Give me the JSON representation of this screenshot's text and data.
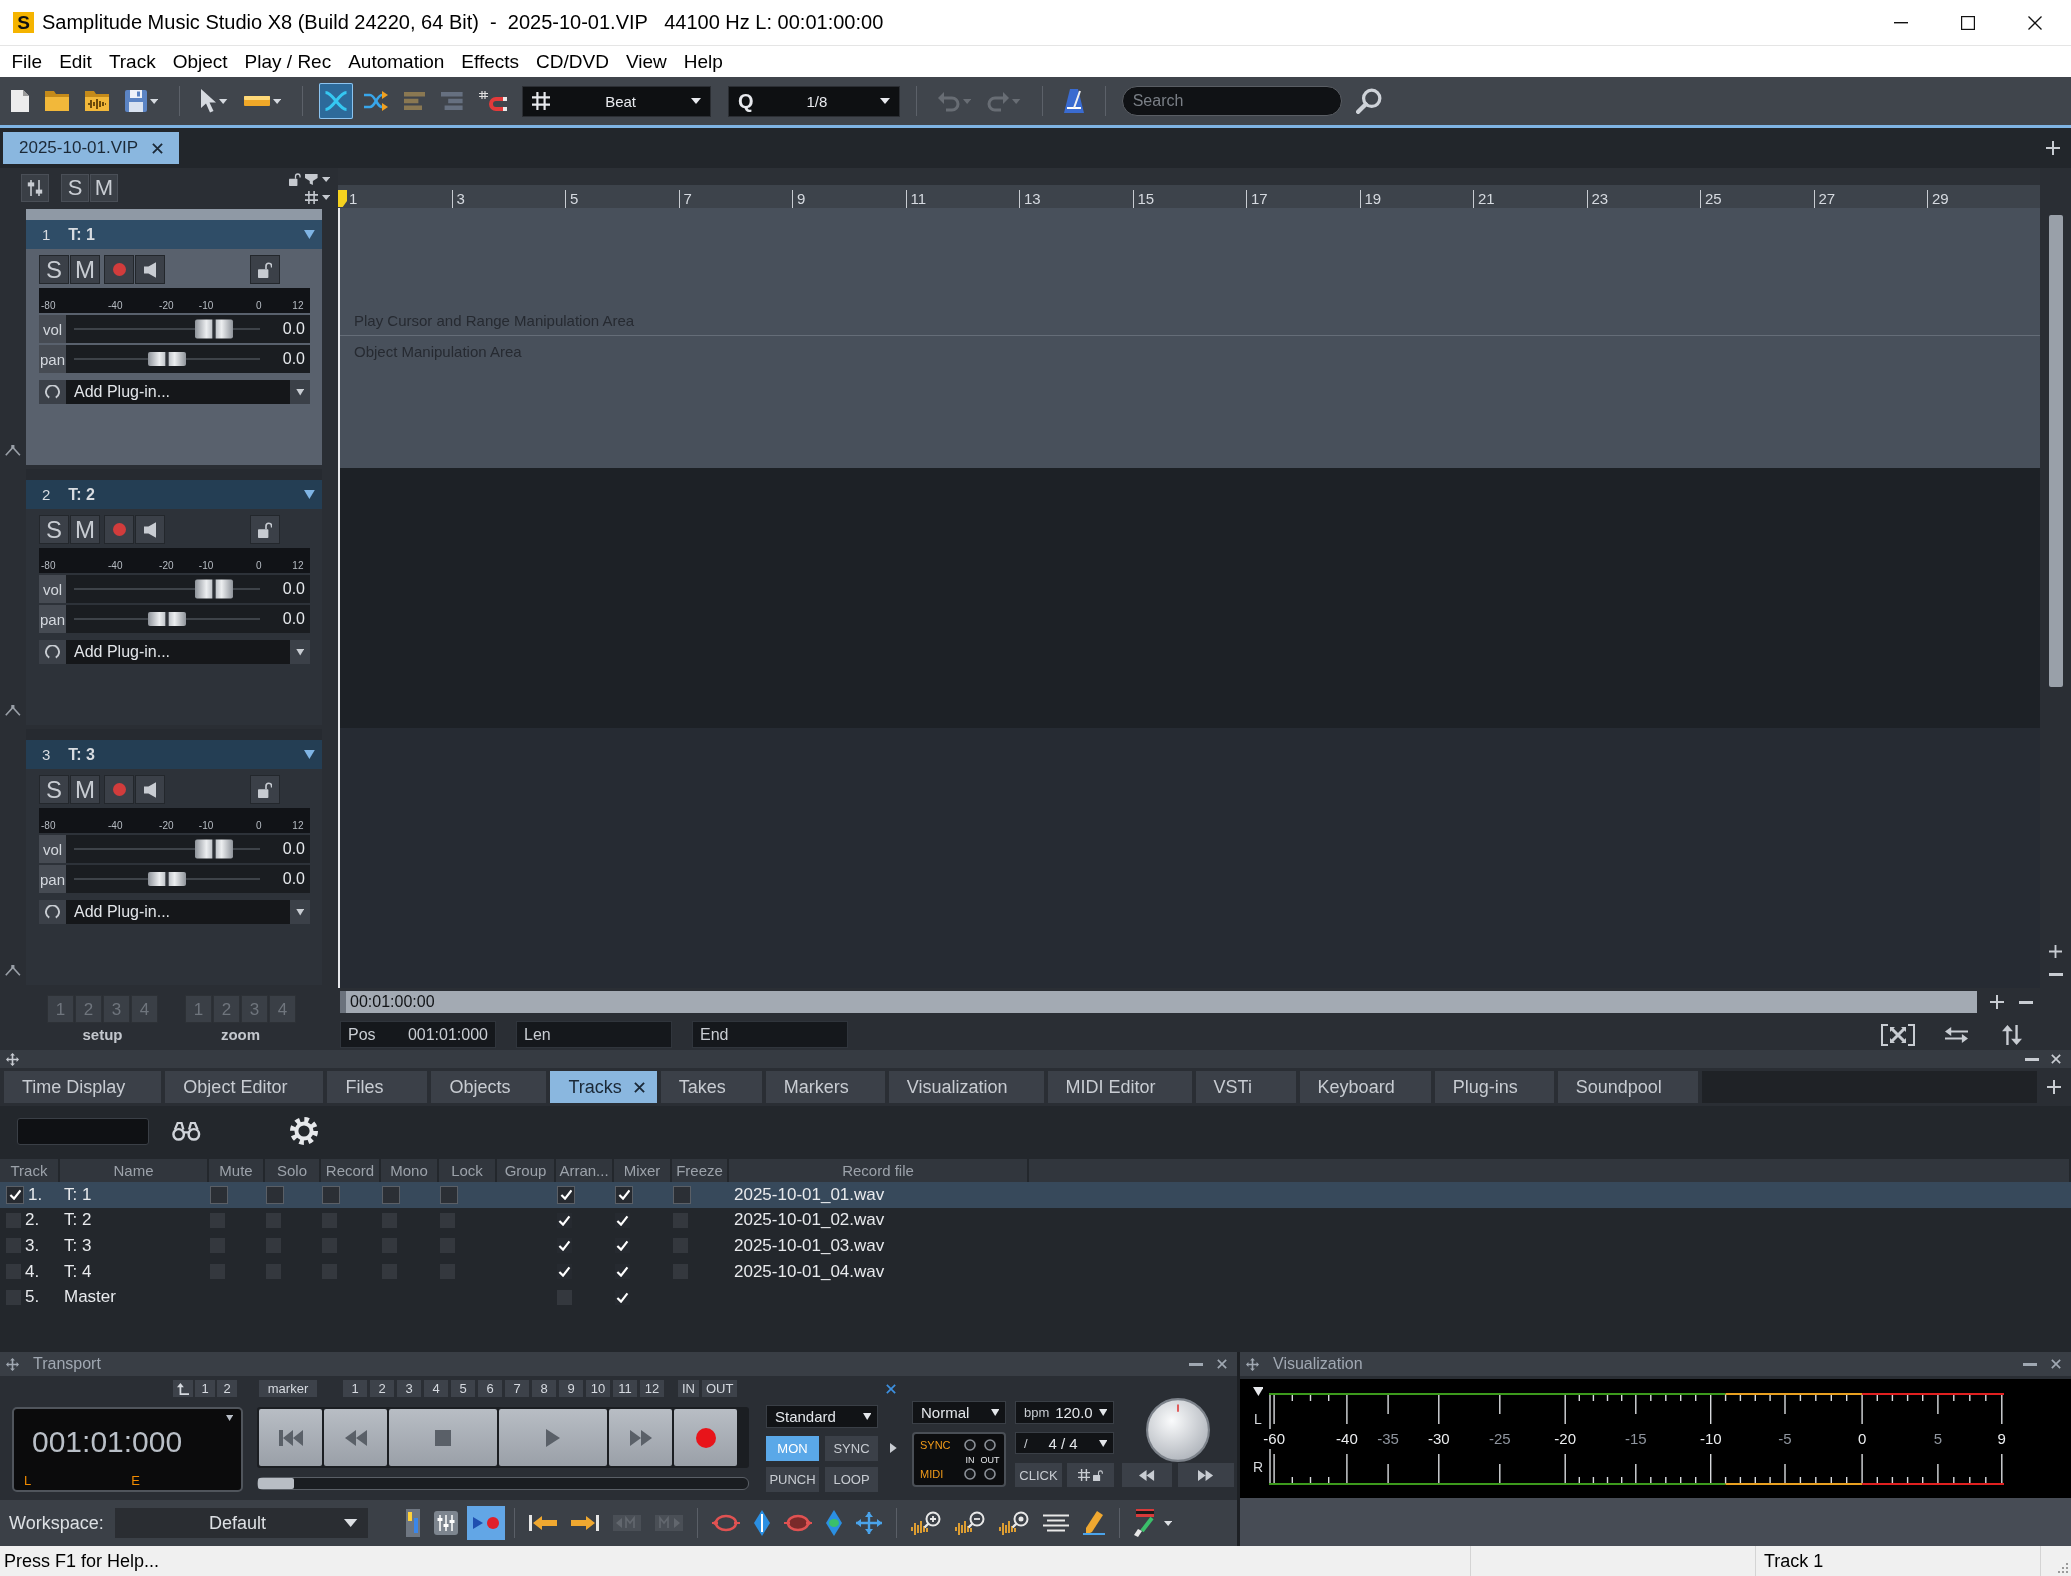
{
  "window": {
    "logo": "S",
    "title": "Samplitude Music Studio X8 (Build 24220, 64 Bit)  -  2025-10-01.VIP   44100 Hz L: 00:01:00:00"
  },
  "menu": [
    "File",
    "Edit",
    "Track",
    "Object",
    "Play / Rec",
    "Automation",
    "Effects",
    "CD/DVD",
    "View",
    "Help"
  ],
  "toolbar": {
    "groups": [
      {
        "buttons": [
          {
            "kind": "new",
            "active": false,
            "disabled": false
          },
          {
            "kind": "open",
            "active": false,
            "disabled": false
          },
          {
            "kind": "project",
            "active": false,
            "disabled": false
          },
          {
            "kind": "save",
            "active": false,
            "disabled": false
          }
        ]
      },
      {
        "buttons": [
          {
            "kind": "pointer",
            "active": false,
            "disabled": false
          },
          {
            "kind": "range",
            "active": false,
            "disabled": false
          }
        ]
      },
      {
        "buttons": [
          {
            "kind": "crossfade",
            "active": true,
            "disabled": false
          },
          {
            "kind": "shuffle",
            "active": false,
            "disabled": false
          },
          {
            "kind": "bars_left",
            "active": false,
            "disabled": false
          },
          {
            "kind": "bars_right",
            "active": false,
            "disabled": false
          },
          {
            "kind": "snap",
            "active": false,
            "disabled": false
          }
        ]
      }
    ],
    "snap": {
      "value": "Beat"
    },
    "quantize": {
      "label": "Q",
      "value": "1/8"
    },
    "more_groups": [
      {
        "buttons": [
          {
            "kind": "undo",
            "active": false,
            "disabled": true
          },
          {
            "kind": "redo",
            "active": false,
            "disabled": true
          }
        ]
      },
      {
        "buttons": [
          {
            "kind": "metronome",
            "active": false,
            "disabled": false
          }
        ]
      }
    ],
    "search": {
      "placeholder": "Search"
    }
  },
  "documents": [
    {
      "label": "2025-10-01.VIP",
      "selected": true
    }
  ],
  "track_header": {
    "buttons": [
      "S",
      "M"
    ]
  },
  "tracks": [
    {
      "number": "1",
      "name": "T: 1",
      "selected": true,
      "solo": {
        "label": "S",
        "on": false
      },
      "mute": {
        "label": "M",
        "on": false
      },
      "armed": false,
      "monitor": false,
      "locked": false,
      "meter_scale": [
        "-80",
        "-40",
        "-20",
        "-10",
        "0",
        "12"
      ],
      "volume": {
        "label": "vol",
        "value": "0.0",
        "level": 0.75
      },
      "pan": {
        "label": "pan",
        "value": "0.0",
        "level": 0.5
      },
      "plugin": "Add Plug-in...",
      "lane_hints": [
        "Play Cursor and Range Manipulation Area",
        "Object Manipulation Area"
      ]
    },
    {
      "number": "2",
      "name": "T: 2",
      "selected": false,
      "solo": {
        "label": "S",
        "on": false
      },
      "mute": {
        "label": "M",
        "on": false
      },
      "armed": false,
      "monitor": false,
      "locked": false,
      "meter_scale": [
        "-80",
        "-40",
        "-20",
        "-10",
        "0",
        "12"
      ],
      "volume": {
        "label": "vol",
        "value": "0.0",
        "level": 0.75
      },
      "pan": {
        "label": "pan",
        "value": "0.0",
        "level": 0.5
      },
      "plugin": "Add Plug-in..."
    },
    {
      "number": "3",
      "name": "T: 3",
      "selected": false,
      "solo": {
        "label": "S",
        "on": false
      },
      "mute": {
        "label": "M",
        "on": false
      },
      "armed": false,
      "monitor": false,
      "locked": false,
      "meter_scale": [
        "-80",
        "-40",
        "-20",
        "-10",
        "0",
        "12"
      ],
      "volume": {
        "label": "vol",
        "value": "0.0",
        "level": 0.75
      },
      "pan": {
        "label": "pan",
        "value": "0.0",
        "level": 0.5
      },
      "plugin": "Add Plug-in..."
    }
  ],
  "left_footer": [
    {
      "label": "setup",
      "buttons": [
        "1",
        "2",
        "3",
        "4"
      ]
    },
    {
      "label": "zoom",
      "buttons": [
        "1",
        "2",
        "3",
        "4"
      ]
    }
  ],
  "arrange": {
    "ruler": [
      "1",
      "3",
      "5",
      "7",
      "9",
      "11",
      "13",
      "15",
      "17",
      "19",
      "21",
      "23",
      "25",
      "27",
      "29"
    ],
    "position": "00:01:00:00",
    "fields": [
      {
        "label": "Pos",
        "value": "001:01:000"
      },
      {
        "label": "Len"
      },
      {
        "label": "End"
      }
    ]
  },
  "dock_tabs": [
    {
      "label": "Time Display",
      "selected": false
    },
    {
      "label": "Object Editor",
      "selected": false
    },
    {
      "label": "Files",
      "selected": false
    },
    {
      "label": "Objects",
      "selected": false
    },
    {
      "label": "Tracks",
      "selected": true
    },
    {
      "label": "Takes",
      "selected": false
    },
    {
      "label": "Markers",
      "selected": false
    },
    {
      "label": "Visualization",
      "selected": false
    },
    {
      "label": "MIDI Editor",
      "selected": false
    },
    {
      "label": "VSTi",
      "selected": false
    },
    {
      "label": "Keyboard",
      "selected": false
    },
    {
      "label": "Plug-ins",
      "selected": false
    },
    {
      "label": "Soundpool",
      "selected": false
    }
  ],
  "track_list": {
    "columns": [
      "Track",
      "Name",
      "Mute",
      "Solo",
      "Record",
      "Mono",
      "Lock",
      "Group",
      "Arran...",
      "Mixer",
      "Freeze",
      "Record file"
    ],
    "rows": [
      {
        "selected": true,
        "checked": true,
        "index": "1.",
        "name": "T: 1",
        "mute": false,
        "solo": false,
        "record": false,
        "mono": false,
        "lock": false,
        "arrange": true,
        "mixer": true,
        "freeze": false,
        "file": "2025-10-01_01.wav"
      },
      {
        "selected": false,
        "checked": false,
        "index": "2.",
        "name": "T: 2",
        "mute": false,
        "solo": false,
        "record": false,
        "mono": false,
        "lock": false,
        "arrange": true,
        "mixer": true,
        "freeze": false,
        "file": "2025-10-01_02.wav"
      },
      {
        "selected": false,
        "checked": false,
        "index": "3.",
        "name": "T: 3",
        "mute": false,
        "solo": false,
        "record": false,
        "mono": false,
        "lock": false,
        "arrange": true,
        "mixer": true,
        "freeze": false,
        "file": "2025-10-01_03.wav"
      },
      {
        "selected": false,
        "checked": false,
        "index": "4.",
        "name": "T: 4",
        "mute": false,
        "solo": false,
        "record": false,
        "mono": false,
        "lock": false,
        "arrange": true,
        "mixer": true,
        "freeze": false,
        "file": "2025-10-01_04.wav"
      },
      {
        "selected": false,
        "checked": false,
        "index": "5.",
        "name": "Master",
        "arrange": false,
        "mixer": true
      }
    ]
  },
  "transport": {
    "title": "Transport",
    "locate_buttons": [
      "1",
      "2"
    ],
    "marker_label": "marker",
    "markers": [
      "1",
      "2",
      "3",
      "4",
      "5",
      "6",
      "7",
      "8",
      "9",
      "10",
      "11",
      "12"
    ],
    "range_buttons": [
      "IN",
      "OUT"
    ],
    "time": "001:01:000",
    "time_flags": [
      "L",
      "E"
    ],
    "controls": [
      {
        "kind": "start"
      },
      {
        "kind": "rewind"
      },
      {
        "kind": "stop"
      },
      {
        "kind": "play"
      },
      {
        "kind": "forward"
      },
      {
        "kind": "record"
      }
    ],
    "mode": "Standard",
    "toggles": [
      {
        "label": "MON",
        "on": true
      },
      {
        "label": "SYNC",
        "on": false
      },
      {
        "label": "PUNCH",
        "on": false
      },
      {
        "label": "LOOP",
        "on": false
      }
    ],
    "play_mode": "Normal",
    "tempo": {
      "label": "bpm",
      "value": "120.0"
    },
    "signature": {
      "label": "/",
      "value": "4 / 4"
    },
    "sync_box": {
      "labels": [
        "SYNC",
        "MIDI"
      ],
      "ports": [
        "IN",
        "OUT"
      ]
    },
    "click": "CLICK"
  },
  "visualization": {
    "title": "Visualization",
    "channels": [
      "L",
      "R"
    ],
    "scale": [
      "-60",
      "-40",
      "-35",
      "-30",
      "-25",
      "-20",
      "-15",
      "-10",
      "-5",
      "0",
      "5",
      "9"
    ]
  },
  "workspace": {
    "label": "Workspace:",
    "value": "Default",
    "groups": [
      {
        "tools": [
          {
            "kind": "strip",
            "active": false,
            "disabled": false
          },
          {
            "kind": "faders",
            "active": false,
            "disabled": false
          },
          {
            "kind": "play_record",
            "active": true,
            "disabled": false
          }
        ]
      },
      {
        "tools": [
          {
            "kind": "jump_left",
            "active": false,
            "disabled": false
          },
          {
            "kind": "jump_right",
            "active": false,
            "disabled": false
          },
          {
            "kind": "marker_left",
            "active": false,
            "disabled": true
          },
          {
            "kind": "marker_right",
            "active": false,
            "disabled": true
          }
        ]
      },
      {
        "tools": [
          {
            "kind": "lens_left",
            "active": false,
            "disabled": false
          },
          {
            "kind": "diamond_left",
            "active": false,
            "disabled": false
          },
          {
            "kind": "lens_right",
            "active": false,
            "disabled": false
          },
          {
            "kind": "diamond_right",
            "active": false,
            "disabled": false
          },
          {
            "kind": "expand",
            "active": false,
            "disabled": false
          }
        ]
      },
      {
        "tools": [
          {
            "kind": "zoom_in",
            "active": false,
            "disabled": false
          },
          {
            "kind": "zoom_out",
            "active": false,
            "disabled": false
          },
          {
            "kind": "zoom_fit",
            "active": false,
            "disabled": false
          },
          {
            "kind": "lines",
            "active": false,
            "disabled": false
          },
          {
            "kind": "pencil",
            "active": false,
            "disabled": false
          }
        ]
      },
      {
        "tools": [
          {
            "kind": "brush",
            "active": false,
            "disabled": false
          }
        ]
      }
    ]
  },
  "status_bar": {
    "help": "Press F1 for Help...",
    "track": "Track 1"
  }
}
